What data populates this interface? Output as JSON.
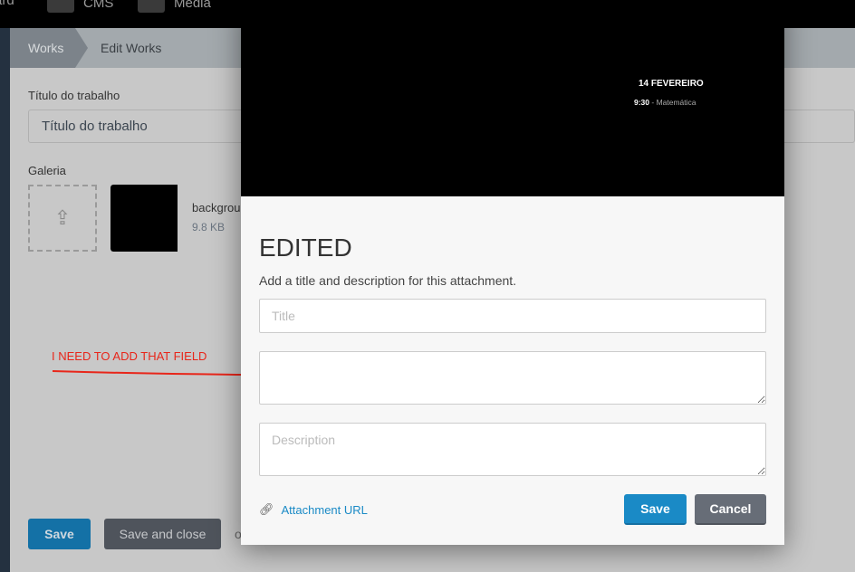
{
  "topnav": {
    "items": [
      {
        "label": "ard",
        "icon": "dashboard-icon"
      },
      {
        "label": "CMS",
        "icon": "cms-icon"
      },
      {
        "label": "Media",
        "icon": "media-icon"
      }
    ]
  },
  "breadcrumb": {
    "items": [
      "Works",
      "Edit Works"
    ]
  },
  "form": {
    "title_label": "Título do trabalho",
    "title_value": "Título do trabalho",
    "gallery_label": "Galeria",
    "file": {
      "name": "backgrou",
      "size": "9.8 KB"
    },
    "save_label": "Save",
    "save_close_label": "Save and close",
    "or_text": "o"
  },
  "annotation": {
    "text": "I NEED TO ADD THAT FIELD",
    "color": "#e8261a"
  },
  "modal": {
    "preview": {
      "date": "14 FEVEREIRO",
      "time": "9:30",
      "subject": " - Matemática"
    },
    "heading": "EDITED",
    "subtitle": "Add a title and description for this attachment.",
    "title_placeholder": "Title",
    "extra_value": "",
    "description_placeholder": "Description",
    "attachment_url_label": "Attachment URL",
    "save_label": "Save",
    "cancel_label": "Cancel"
  },
  "colors": {
    "primary": "#1a8ac6",
    "secondary": "#676d77",
    "dim_primary": "#1471a6",
    "dim_secondary": "#4f545c"
  }
}
